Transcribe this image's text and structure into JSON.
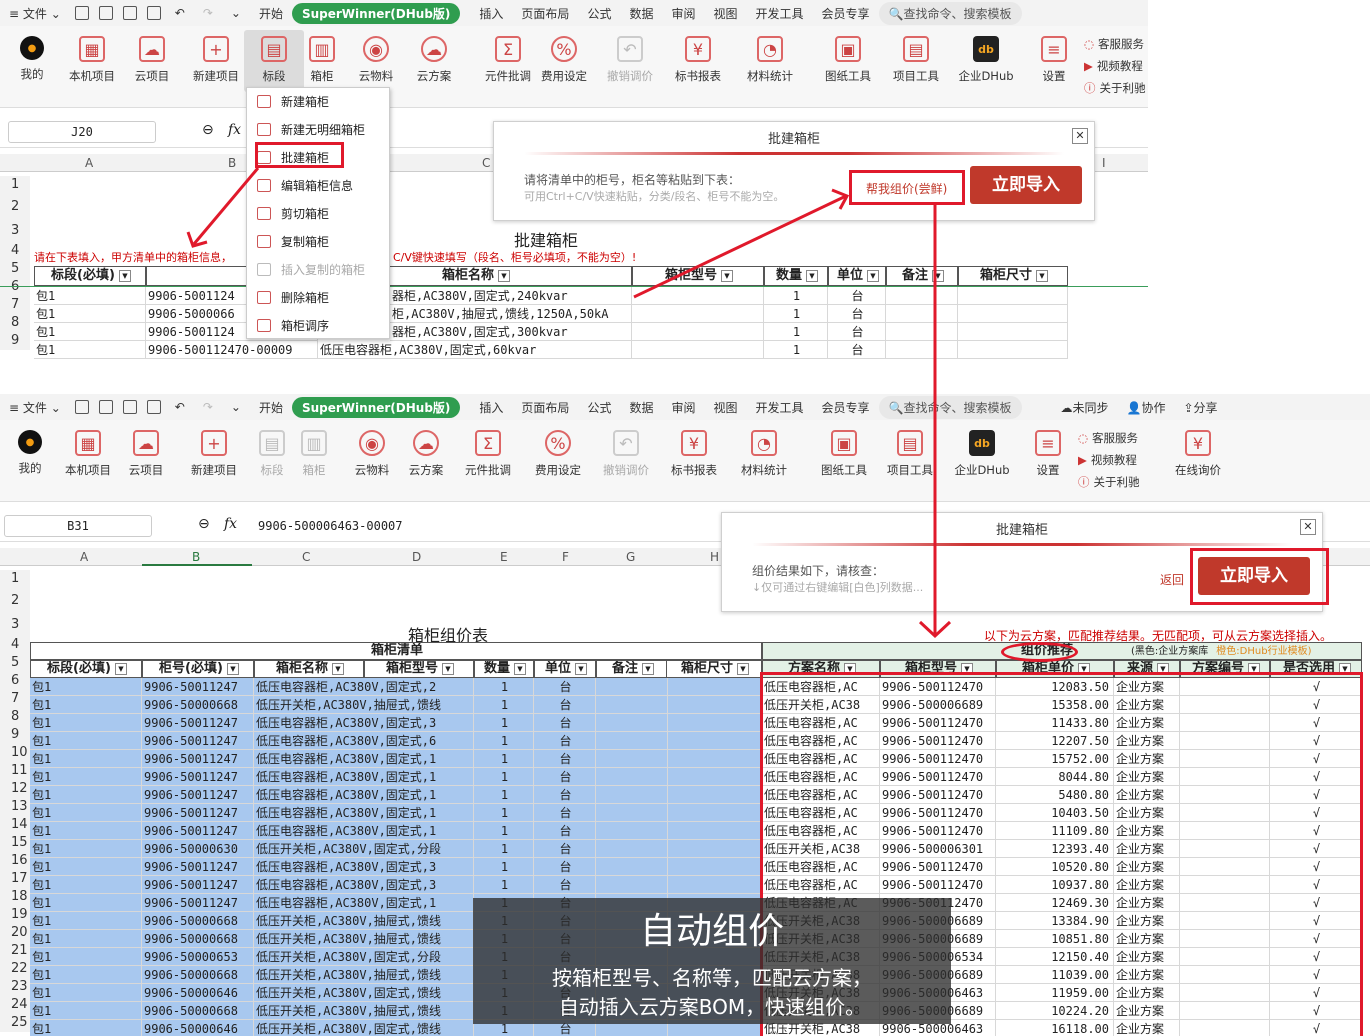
{
  "top": {
    "menu": {
      "file": "文件",
      "tabs": [
        "开始",
        "SuperWinner(DHub版)",
        "插入",
        "页面布局",
        "公式",
        "数据",
        "审阅",
        "视图",
        "开发工具",
        "会员专享"
      ],
      "search": "查找命令、搜索模板"
    },
    "ribbon": [
      "我的",
      "本机项目",
      "云项目",
      "新建项目",
      "标段",
      "箱柜",
      "云物料",
      "云方案",
      "元件批调",
      "费用设定",
      "撤销调价",
      "标书报表",
      "材料统计",
      "图纸工具",
      "项目工具",
      "企业DHub",
      "设置"
    ],
    "side": [
      "客服服务",
      "视频教程",
      "关于利驰"
    ],
    "namebox": "J20",
    "fx": "fx",
    "cols": [
      "A",
      "B",
      "C",
      "I"
    ],
    "rows": [
      "1",
      "2",
      "3",
      "4",
      "5",
      "6",
      "7",
      "8",
      "9"
    ],
    "dropdown": [
      "新建箱柜",
      "新建无明细箱柜",
      "批建箱柜",
      "编辑箱柜信息",
      "剪切箱柜",
      "复制箱柜",
      "插入复制的箱柜",
      "删除箱柜",
      "箱柜调序"
    ],
    "sheet_title": "批建箱柜",
    "notice": "请在下表填入，甲方清单中的箱柜信息，",
    "notice2": "C/V键快速填写（段名、柜号必填项，不能为空）!",
    "headers": [
      "标段(必填)",
      "柜号(必填)",
      "箱柜名称",
      "箱柜型号",
      "数量",
      "单位",
      "备注",
      "箱柜尺寸"
    ],
    "data": [
      [
        "包1",
        "9906-5001124",
        "器柜,AC380V,固定式,240kvar",
        "1",
        "台"
      ],
      [
        "包1",
        "9906-5000066",
        "柜,AC380V,抽屉式,馈线,1250A,50kA",
        "1",
        "台"
      ],
      [
        "包1",
        "9906-5001124",
        "器柜,AC380V,固定式,300kvar",
        "1",
        "台"
      ],
      [
        "包1",
        "9906-500112470-00009",
        "低压电容器柜,AC380V,固定式,60kvar",
        "1",
        "台"
      ]
    ],
    "dialog": {
      "title": "批建箱柜",
      "line1": "请将清单中的柜号，柜名等粘贴到下表：",
      "line2": "可用Ctrl+C/V快速粘贴，分类/段名、柜号不能为空。",
      "help": "帮我组价(尝鲜)",
      "import": "立即导入",
      "close": "✕"
    }
  },
  "bottom": {
    "menu": {
      "file": "文件",
      "tabs": [
        "开始",
        "SuperWinner(DHub版)",
        "插入",
        "页面布局",
        "公式",
        "数据",
        "审阅",
        "视图",
        "开发工具",
        "会员专享"
      ],
      "search": "查找命令、搜索模板",
      "right": [
        "未同步",
        "协作",
        "分享"
      ]
    },
    "ribbon": [
      "我的",
      "本机项目",
      "云项目",
      "新建项目",
      "标段",
      "箱柜",
      "云物料",
      "云方案",
      "元件批调",
      "费用设定",
      "撤销调价",
      "标书报表",
      "材料统计",
      "图纸工具",
      "项目工具",
      "企业DHub",
      "设置",
      "在线询价"
    ],
    "side": [
      "客服服务",
      "视频教程",
      "关于利驰"
    ],
    "namebox": "B31",
    "fx": "fx",
    "formula": "9906-500006463-00007",
    "cols": [
      "A",
      "B",
      "C",
      "D",
      "E",
      "F",
      "G",
      "H"
    ],
    "rows": [
      "1",
      "2",
      "3",
      "4",
      "5",
      "6",
      "7",
      "8",
      "9",
      "10",
      "11",
      "12",
      "13",
      "14",
      "15",
      "16",
      "17",
      "18",
      "19",
      "20",
      "21",
      "22",
      "23",
      "24",
      "25"
    ],
    "sheet_title": "箱柜组价表",
    "group_left": "箱柜清单",
    "group_right": "组价推荐",
    "cloud_note": "以下为云方案，匹配推荐结果。无匹配项，可从云方案选择插入。",
    "legend_black": "(黑色:企业方案库",
    "legend_orange": "橙色:DHub行业模板)",
    "headers_left": [
      "标段(必填)",
      "柜号(必填)",
      "箱柜名称",
      "箱柜型号",
      "数量",
      "单位",
      "备注",
      "箱柜尺寸"
    ],
    "headers_right": [
      "方案名称",
      "箱柜型号",
      "箱柜单价",
      "来源",
      "方案编号",
      "是否选用"
    ],
    "rows_data": [
      [
        "包1",
        "9906-50011247",
        "低压电容器柜,AC380V,固定式,2",
        "1",
        "台",
        "低压电容器柜,AC",
        "9906-500112470",
        "12083.50",
        "企业方案",
        "√"
      ],
      [
        "包1",
        "9906-50000668",
        "低压开关柜,AC380V,抽屉式,馈线",
        "1",
        "台",
        "低压开关柜,AC38",
        "9906-500006689",
        "15358.00",
        "企业方案",
        "√"
      ],
      [
        "包1",
        "9906-50011247",
        "低压电容器柜,AC380V,固定式,3",
        "1",
        "台",
        "低压电容器柜,AC",
        "9906-500112470",
        "11433.80",
        "企业方案",
        "√"
      ],
      [
        "包1",
        "9906-50011247",
        "低压电容器柜,AC380V,固定式,6",
        "1",
        "台",
        "低压电容器柜,AC",
        "9906-500112470",
        "12207.50",
        "企业方案",
        "√"
      ],
      [
        "包1",
        "9906-50011247",
        "低压电容器柜,AC380V,固定式,1",
        "1",
        "台",
        "低压电容器柜,AC",
        "9906-500112470",
        "15752.00",
        "企业方案",
        "√"
      ],
      [
        "包1",
        "9906-50011247",
        "低压电容器柜,AC380V,固定式,1",
        "1",
        "台",
        "低压电容器柜,AC",
        "9906-500112470",
        "8044.80",
        "企业方案",
        "√"
      ],
      [
        "包1",
        "9906-50011247",
        "低压电容器柜,AC380V,固定式,1",
        "1",
        "台",
        "低压电容器柜,AC",
        "9906-500112470",
        "5480.80",
        "企业方案",
        "√"
      ],
      [
        "包1",
        "9906-50011247",
        "低压电容器柜,AC380V,固定式,1",
        "1",
        "台",
        "低压电容器柜,AC",
        "9906-500112470",
        "10403.50",
        "企业方案",
        "√"
      ],
      [
        "包1",
        "9906-50011247",
        "低压电容器柜,AC380V,固定式,1",
        "1",
        "台",
        "低压电容器柜,AC",
        "9906-500112470",
        "11109.80",
        "企业方案",
        "√"
      ],
      [
        "包1",
        "9906-50000630",
        "低压开关柜,AC380V,固定式,分段",
        "1",
        "台",
        "低压开关柜,AC38",
        "9906-500006301",
        "12393.40",
        "企业方案",
        "√"
      ],
      [
        "包1",
        "9906-50011247",
        "低压电容器柜,AC380V,固定式,3",
        "1",
        "台",
        "低压电容器柜,AC",
        "9906-500112470",
        "10520.80",
        "企业方案",
        "√"
      ],
      [
        "包1",
        "9906-50011247",
        "低压电容器柜,AC380V,固定式,3",
        "1",
        "台",
        "低压电容器柜,AC",
        "9906-500112470",
        "10937.80",
        "企业方案",
        "√"
      ],
      [
        "包1",
        "9906-50011247",
        "低压电容器柜,AC380V,固定式,1",
        "1",
        "台",
        "低压电容器柜,AC",
        "9906-500112470",
        "12469.30",
        "企业方案",
        "√"
      ],
      [
        "包1",
        "9906-50000668",
        "低压开关柜,AC380V,抽屉式,馈线",
        "1",
        "台",
        "低压开关柜,AC38",
        "9906-500006689",
        "13384.90",
        "企业方案",
        "√"
      ],
      [
        "包1",
        "9906-50000668",
        "低压开关柜,AC380V,抽屉式,馈线",
        "1",
        "台",
        "低压开关柜,AC38",
        "9906-500006689",
        "10851.80",
        "企业方案",
        "√"
      ],
      [
        "包1",
        "9906-50000653",
        "低压开关柜,AC380V,固定式,分段",
        "1",
        "台",
        "低压开关柜,AC38",
        "9906-500006534",
        "12150.40",
        "企业方案",
        "√"
      ],
      [
        "包1",
        "9906-50000668",
        "低压开关柜,AC380V,抽屉式,馈线",
        "1",
        "台",
        "低压开关柜,AC38",
        "9906-500006689",
        "11039.00",
        "企业方案",
        "√"
      ],
      [
        "包1",
        "9906-50000646",
        "低压开关柜,AC380V,固定式,馈线",
        "1",
        "台",
        "低压开关柜,AC38",
        "9906-500006463",
        "11959.00",
        "企业方案",
        "√"
      ],
      [
        "包1",
        "9906-50000668",
        "低压开关柜,AC380V,抽屉式,馈线",
        "1",
        "台",
        "低压开关柜,AC38",
        "9906-500006689",
        "10224.20",
        "企业方案",
        "√"
      ],
      [
        "包1",
        "9906-50000646",
        "低压开关柜,AC380V,固定式,馈线",
        "1",
        "台",
        "低压开关柜,AC38",
        "9906-500006463",
        "16118.00",
        "企业方案",
        "√"
      ]
    ],
    "dialog": {
      "title": "批建箱柜",
      "line1": "组价结果如下，请核查：",
      "line2": "↓仅可通过右键编辑[白色]列数据...",
      "back": "返回",
      "import": "立即导入",
      "close": "✕"
    }
  },
  "overlay": {
    "title": "自动组价",
    "line1": "按箱柜型号、名称等，匹配云方案，",
    "line2": "自动插入云方案BOM，快速组价。"
  },
  "colors": {
    "accent": "#2f9d4f",
    "red": "#e0192b",
    "import": "#c0392b",
    "selection": "#a8c8ef"
  }
}
